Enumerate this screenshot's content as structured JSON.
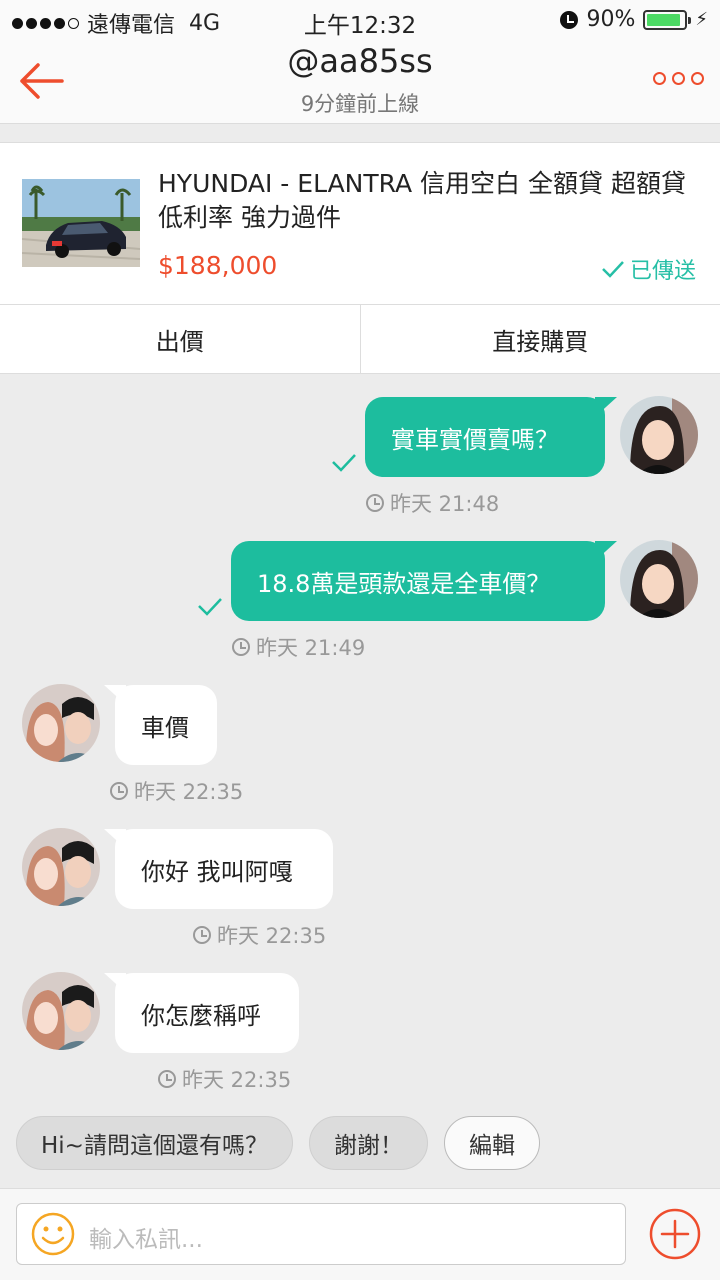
{
  "status_bar": {
    "carrier": "遠傳電信",
    "network": "4G",
    "time": "上午12:32",
    "battery": "90%",
    "battery_level": 0.9
  },
  "header": {
    "title": "@aa85ss",
    "subtitle": "9分鐘前上線"
  },
  "product": {
    "title": "HYUNDAI - ELANTRA  信用空白 全額貸 超額貸  低利率 強力過件",
    "price": "$188,000",
    "status": "已傳送",
    "offer_label": "出價",
    "buy_label": "直接購買"
  },
  "messages": [
    {
      "direction": "out",
      "text": "實車實價賣嗎？",
      "time": "昨天 21:48"
    },
    {
      "direction": "out",
      "text": "18.8萬是頭款還是全車價？",
      "time": "昨天 21:49"
    },
    {
      "direction": "in",
      "text": "車價",
      "time": "昨天 22:35"
    },
    {
      "direction": "in",
      "text": "你好 我叫阿嘎",
      "time": "昨天 22:35"
    },
    {
      "direction": "in",
      "text": "你怎麼稱呼",
      "time": "昨天 22:35"
    }
  ],
  "quick_replies": [
    "Hi~請問這個還有嗎？",
    "謝謝！"
  ],
  "edit_label": "編輯",
  "composer": {
    "placeholder": "輸入私訊..."
  },
  "colors": {
    "accent": "#ee4d2d",
    "bubble_out": "#1dbd9e",
    "check": "#26bfa6"
  }
}
